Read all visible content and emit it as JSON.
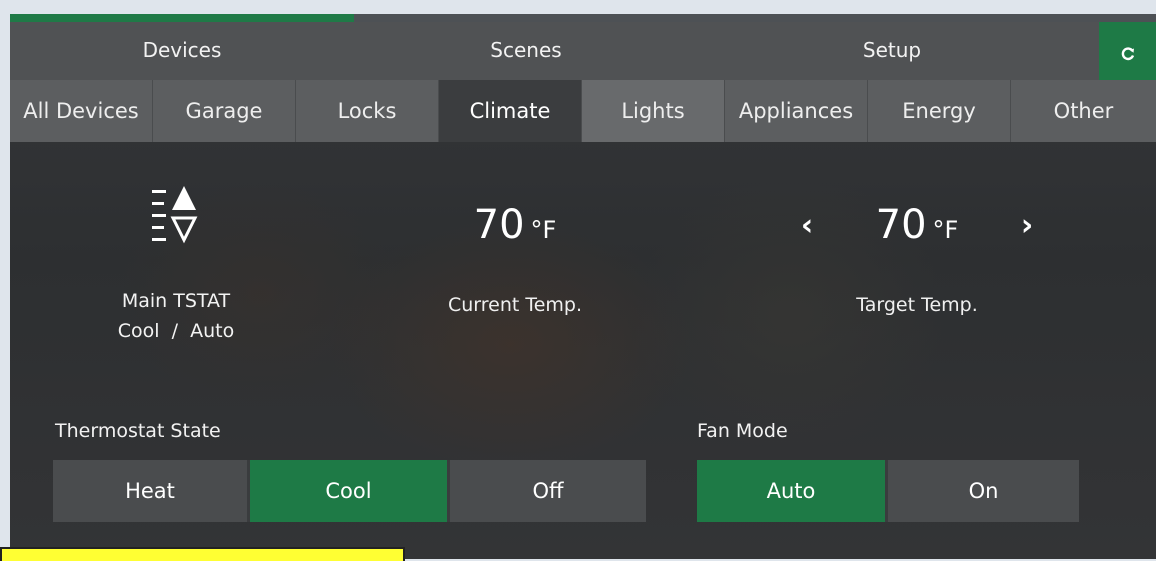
{
  "progress": {
    "fraction": 0.3
  },
  "main_tabs": [
    {
      "label": "Devices"
    },
    {
      "label": "Scenes"
    },
    {
      "label": "Setup"
    }
  ],
  "refresh": {
    "icon": "refresh-icon",
    "glyph": "C"
  },
  "sub_tabs": [
    {
      "label": "All Devices"
    },
    {
      "label": "Garage"
    },
    {
      "label": "Locks"
    },
    {
      "label": "Climate",
      "active": true
    },
    {
      "label": "Lights"
    },
    {
      "label": "Appliances"
    },
    {
      "label": "Energy"
    },
    {
      "label": "Other"
    }
  ],
  "thermostat": {
    "icon": "thermostat-icon",
    "name": "Main TSTAT",
    "mode": "Cool  /  Auto"
  },
  "current_temp": {
    "value": "70",
    "unit": "°F",
    "label": "Current Temp."
  },
  "target_temp": {
    "value": "70",
    "unit": "°F",
    "label": "Target Temp.",
    "decrease": "‹",
    "increase": "›"
  },
  "thermostat_state": {
    "label": "Thermostat State",
    "options": [
      {
        "label": "Heat"
      },
      {
        "label": "Cool",
        "selected": true
      },
      {
        "label": "Off"
      }
    ]
  },
  "fan_mode": {
    "label": "Fan Mode",
    "options": [
      {
        "label": "Auto",
        "selected": true
      },
      {
        "label": "On"
      }
    ]
  },
  "colors": {
    "accent": "#1e7a46",
    "tab": "#5c5e60",
    "active_tab": "#3b3d3f"
  }
}
